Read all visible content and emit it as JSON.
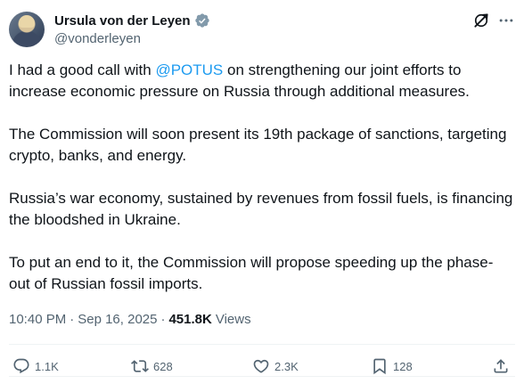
{
  "author": {
    "display_name": "Ursula von der Leyen",
    "handle": "@vonderleyen",
    "verified_color": "#829aab"
  },
  "tweet": {
    "p1_before": "I had a good call with ",
    "p1_mention": "@POTUS",
    "p1_after": " on strengthening our joint efforts to increase economic pressure on Russia through additional measures.",
    "p2": "The Commission will soon present its 19th package of sanctions, targeting crypto, banks, and energy.",
    "p3": "Russia’s war economy, sustained by revenues from fossil fuels, is financing the bloodshed in Ukraine.",
    "p4": "To put an end to it, the Commission will propose speeding up the phase-out of Russian fossil imports."
  },
  "meta": {
    "time": "10:40 PM",
    "date": "Sep 16, 2025",
    "views_count": "451.8K",
    "views_label": "Views"
  },
  "actions": {
    "replies": "1.1K",
    "reposts": "628",
    "likes": "2.3K",
    "bookmarks": "128"
  },
  "colors": {
    "accent": "#1d9bf0",
    "text": "#0f1419",
    "muted": "#536471"
  }
}
